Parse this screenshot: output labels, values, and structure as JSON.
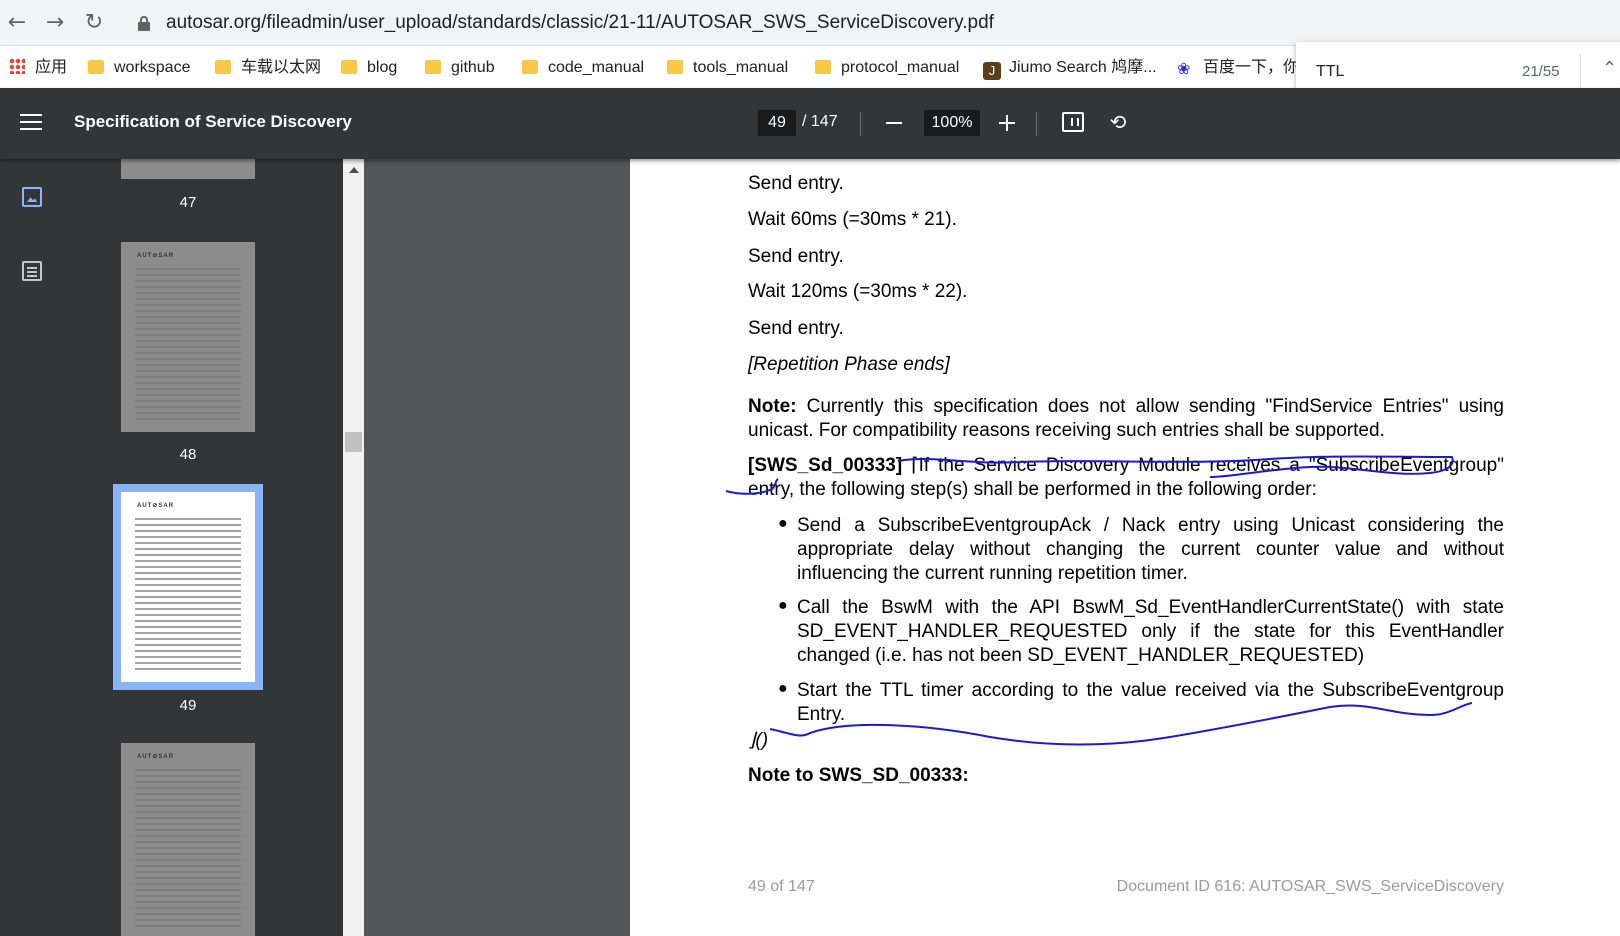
{
  "browser": {
    "url": "autosar.org/fileadmin/user_upload/standards/classic/21-11/AUTOSAR_SWS_ServiceDiscovery.pdf",
    "bookmarks": [
      {
        "label": "应用",
        "icon": "apps-grid-icon"
      },
      {
        "label": "workspace",
        "icon": "folder-icon"
      },
      {
        "label": "车载以太网",
        "icon": "folder-icon"
      },
      {
        "label": "blog",
        "icon": "folder-icon"
      },
      {
        "label": "github",
        "icon": "folder-icon"
      },
      {
        "label": "code_manual",
        "icon": "folder-icon"
      },
      {
        "label": "tools_manual",
        "icon": "folder-icon"
      },
      {
        "label": "protocol_manual",
        "icon": "folder-icon"
      },
      {
        "label": "Jiumo Search 鸠摩...",
        "icon": "jiumo-icon"
      },
      {
        "label": "百度一下，你",
        "icon": "baidu-paw-icon"
      }
    ],
    "find": {
      "query": "TTL",
      "count": "21/55"
    }
  },
  "pdf_toolbar": {
    "title": "Specification of Service Discovery",
    "page": "49",
    "total": "/ 147",
    "zoom": "100%"
  },
  "thumbnails": {
    "brand": "AUT⊘SAR",
    "labels": [
      "47",
      "48",
      "49"
    ],
    "active": "49"
  },
  "document": {
    "lines": [
      "Send entry.",
      "Wait 60ms (=30ms * 21).",
      "Send entry.",
      "Wait 120ms (=30ms * 22).",
      "Send entry.",
      "[Repetition Phase ends]"
    ],
    "note_label": "Note:",
    "note_text": "Currently this specification does not allow sending \"FindService Entries\" using unicast. For compatibility reasons receiving such entries shall be supported.",
    "req_id": "[SWS_Sd_00333]",
    "req_text": "⌈If the Service Discovery Module receives a \"SubscribeEventgroup\" entry, the following step(s) shall be performed in the following order:",
    "bullets": [
      "Send a SubscribeEventgroupAck / Nack entry using Unicast considering the appropriate delay without changing the current counter value and without influencing the current running repetition timer.",
      "Call the BswM with the API BswM_Sd_EventHandlerCurrentState() with state SD_EVENT_HANDLER_REQUESTED only if the state for this EventHandler changed (i.e. has not been SD_EVENT_HANDLER_REQUESTED)",
      "Start the TTL timer according to the value received via the SubscribeEventgroup Entry."
    ],
    "req_end": "⌋()",
    "note2": "Note to SWS_SD_00333:",
    "footer_left": "49 of 147",
    "footer_right": "Document ID 616: AUTOSAR_SWS_ServiceDiscovery"
  },
  "colors": {
    "annotation_ink": "#1a1ad4",
    "thumb_highlight": "#8ab4f8"
  }
}
